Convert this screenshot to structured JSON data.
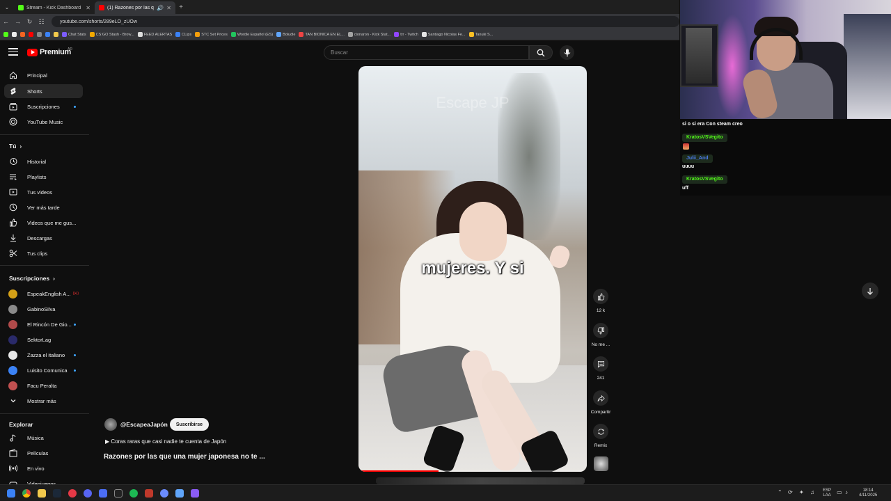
{
  "browser": {
    "tabs": [
      {
        "label": "Stream - Kick Dashboard",
        "favicon_color": "#53fc18"
      },
      {
        "label": "(1) Razones por las que una",
        "favicon_color": "#ff0000"
      }
    ],
    "url": "youtube.com/shorts/289eLO_zUOw",
    "bookmarks": [
      {
        "label": "Chat Stats",
        "color": "#7c5cff"
      },
      {
        "label": "CS:GO Stash - Brow...",
        "color": "#f2a900"
      },
      {
        "label": "FEED ALERTAS",
        "color": "#dddddd"
      },
      {
        "label": "CLips",
        "color": "#3b82f6"
      },
      {
        "label": "STC Set Prices",
        "color": "#f59e0b"
      },
      {
        "label": "Wordle Español (ES)",
        "color": "#22c55e"
      },
      {
        "label": "Boludle",
        "color": "#60a5fa"
      },
      {
        "label": "TAN BIONICA EN EL...",
        "color": "#ef4444"
      },
      {
        "label": "cionaron - Kick Stat...",
        "color": "#a3a3a3"
      },
      {
        "label": "trr - Twitch",
        "color": "#9146ff"
      },
      {
        "label": "Santiago Nicolas Fe...",
        "color": "#e5e5e5"
      },
      {
        "label": "Tanuki S...",
        "color": "#fbbf24"
      }
    ]
  },
  "youtube": {
    "logo_text": "Premium",
    "logo_region": "AR",
    "search_placeholder": "Buscar"
  },
  "sidebar": {
    "main": [
      {
        "label": "Principal",
        "icon": "home-icon"
      },
      {
        "label": "Shorts",
        "icon": "shorts-icon",
        "active": true
      },
      {
        "label": "Suscripciones",
        "icon": "subscriptions-icon",
        "dot": true
      },
      {
        "label": "YouTube Music",
        "icon": "music-circle-icon"
      }
    ],
    "you_title": "Tú",
    "you": [
      {
        "label": "Historial",
        "icon": "history-icon"
      },
      {
        "label": "Playlists",
        "icon": "playlists-icon"
      },
      {
        "label": "Tus videos",
        "icon": "your-videos-icon"
      },
      {
        "label": "Ver más tarde",
        "icon": "watch-later-icon"
      },
      {
        "label": "Videos que me gus...",
        "icon": "liked-icon"
      },
      {
        "label": "Descargas",
        "icon": "download-icon"
      },
      {
        "label": "Tus clips",
        "icon": "clips-icon"
      }
    ],
    "subs_title": "Suscripciones",
    "subscriptions": [
      {
        "label": "EspeakEnglish A...",
        "avatar_color": "#d4a017",
        "live": true
      },
      {
        "label": "GabinoSilva",
        "avatar_color": "#8a8a8a"
      },
      {
        "label": "El Rincón De Gio...",
        "avatar_color": "#b04a4a",
        "dot": true
      },
      {
        "label": "SektorLag",
        "avatar_color": "#2a2a6a"
      },
      {
        "label": "Zazza el italiano",
        "avatar_color": "#e8e8e8",
        "dot": true
      },
      {
        "label": "Luisito Comunica",
        "avatar_color": "#3b82f6",
        "dot": true
      },
      {
        "label": "Facu Peralta",
        "avatar_color": "#c05050"
      }
    ],
    "show_more": "Mostrar más",
    "explore_title": "Explorar",
    "explore": [
      {
        "label": "Música",
        "icon": "music-note-icon"
      },
      {
        "label": "Películas",
        "icon": "movies-icon"
      },
      {
        "label": "En vivo",
        "icon": "live-icon"
      },
      {
        "label": "Videojuegos",
        "icon": "gaming-icon"
      }
    ]
  },
  "short": {
    "watermark": "Escape JP",
    "caption": "mujeres. Y si",
    "progress": 0.35,
    "channel": "@EscapeaJapón",
    "subscribe_label": "Suscribirse",
    "sound": "Coras raras que casi nadie te cuenta de Japón",
    "title": "Razones por las que una mujer japonesa no te ..."
  },
  "actions": {
    "like_count": "12 k",
    "dislike_label": "No me ...",
    "comments_count": "241",
    "share_label": "Compartir",
    "remix_label": "Remix"
  },
  "chat": {
    "top_message": "si o si era Con steam creo",
    "messages": [
      {
        "user": "KratosVSVegito",
        "user_color": "#53fc18",
        "text": "",
        "emote": true
      },
      {
        "user": "Julii_And",
        "user_color": "#4b7bec",
        "text": "uuuu"
      },
      {
        "user": "KratosVSVegito",
        "user_color": "#53fc18",
        "text": "uff"
      }
    ]
  },
  "taskbar": {
    "lang_top": "ESP",
    "lang_bottom": "LAA",
    "time": "18:14",
    "date": "4/11/2025"
  }
}
